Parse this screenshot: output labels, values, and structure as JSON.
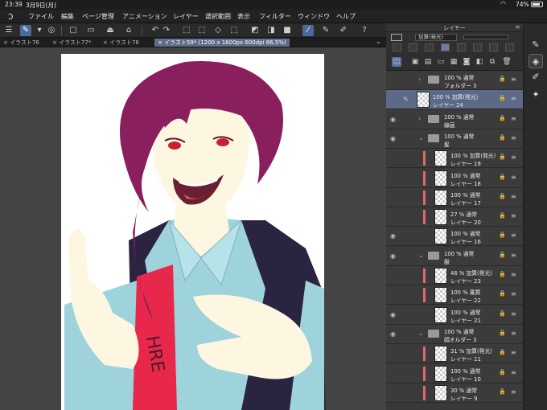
{
  "statusbar": {
    "time": "23:39",
    "date": "3月9日(月)",
    "battery": "74%"
  },
  "menubar": {
    "items": [
      "ファイル",
      "編集",
      "ページ管理",
      "アニメーション",
      "レイヤー",
      "選択範囲",
      "表示",
      "フィルター",
      "ウィンドウ",
      "ヘルプ"
    ]
  },
  "tabs": {
    "items": [
      "× イラスト76",
      "× イラスト77*",
      "× イラスト78",
      "× イラスト59* (1200 x 1600px 600dpi 86.5%)"
    ]
  },
  "layer_panel": {
    "title": "レイヤー",
    "blend_mode": "加算(発光)",
    "layers": [
      {
        "line1": "100 % 通常",
        "line2": "フォルダー 3",
        "kind": "folder",
        "eye": false,
        "indent": 0
      },
      {
        "line1": "100 % 加算(発光)",
        "line2": "レイヤー 24",
        "kind": "layer",
        "eye": false,
        "indent": 0,
        "selected": true
      },
      {
        "line1": "100 % 通常",
        "line2": "線画",
        "kind": "folder",
        "eye": true,
        "indent": 0
      },
      {
        "line1": "100 % 通常",
        "line2": "髪",
        "kind": "folder",
        "eye": true,
        "indent": 0,
        "open": true
      },
      {
        "line1": "100 % 加算(発光)",
        "line2": "レイヤー 19",
        "kind": "layer",
        "eye": false,
        "indent": 1,
        "marked": true
      },
      {
        "line1": "100 % 通常",
        "line2": "レイヤー 18",
        "kind": "layer",
        "eye": false,
        "indent": 1,
        "marked": true
      },
      {
        "line1": "100 % 通常",
        "line2": "レイヤー 17",
        "kind": "layer",
        "eye": false,
        "indent": 1,
        "marked": true
      },
      {
        "line1": "27 % 通常",
        "line2": "レイヤー 20",
        "kind": "layer",
        "eye": false,
        "indent": 1,
        "marked": true
      },
      {
        "line1": "100 % 通常",
        "line2": "レイヤー 16",
        "kind": "layer",
        "eye": true,
        "indent": 1
      },
      {
        "line1": "100 % 通常",
        "line2": "服",
        "kind": "folder",
        "eye": true,
        "indent": 0,
        "open": true
      },
      {
        "line1": "46 % 加算(発光)",
        "line2": "レイヤー 23",
        "kind": "layer",
        "eye": false,
        "indent": 1,
        "marked": true
      },
      {
        "line1": "100 % 乗算",
        "line2": "レイヤー 22",
        "kind": "layer",
        "eye": false,
        "indent": 1,
        "marked": true
      },
      {
        "line1": "100 % 通常",
        "line2": "レイヤー 21",
        "kind": "layer",
        "eye": true,
        "indent": 1
      },
      {
        "line1": "100 % 通常",
        "line2": "顔オルダー 3",
        "kind": "folder",
        "eye": true,
        "indent": 0,
        "open": true
      },
      {
        "line1": "31 % 加算(発光)",
        "line2": "レイヤー 11",
        "kind": "layer",
        "eye": false,
        "indent": 1,
        "marked": true
      },
      {
        "line1": "100 % 通常",
        "line2": "レイヤー 10",
        "kind": "layer",
        "eye": false,
        "indent": 1,
        "marked": true
      },
      {
        "line1": "30 % 通常",
        "line2": "レイヤー 9",
        "kind": "layer",
        "eye": false,
        "indent": 1,
        "marked": true
      }
    ]
  },
  "colors": {
    "hair": "#8a1f5e",
    "shirt": "#9fd3dc",
    "vest": "#2a2440",
    "tie": "#e8284a",
    "skin": "#fdf6e0",
    "selection": "#5c6a87"
  },
  "artwork": {
    "tie_text": "HRE"
  }
}
